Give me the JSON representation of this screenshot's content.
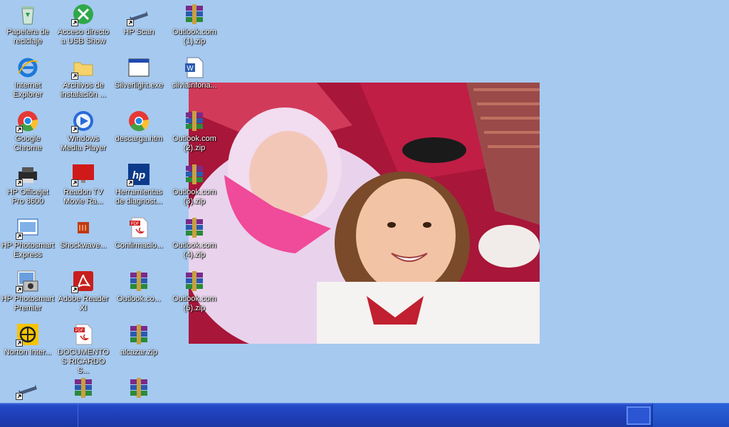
{
  "desktop": {
    "background_color": "#a6c9f0",
    "icons": [
      {
        "label": "Papelera de reciclaje",
        "icon": "recycle-bin-icon",
        "shortcut": false
      },
      {
        "label": "Acceso directo a USB Show",
        "icon": "usb-show-icon",
        "shortcut": true
      },
      {
        "label": "HP Scan",
        "icon": "scanner-icon",
        "shortcut": true
      },
      {
        "label": "Outlook.com (1).zip",
        "icon": "winrar-archive-icon",
        "shortcut": false
      },
      {
        "label": "Internet Explorer",
        "icon": "internet-explorer-icon",
        "shortcut": false
      },
      {
        "label": "Archivos de instalación ...",
        "icon": "folder-icon",
        "shortcut": true
      },
      {
        "label": "Silverlight.exe",
        "icon": "application-window-icon",
        "shortcut": false
      },
      {
        "label": "silviainfona...",
        "icon": "word-document-icon",
        "shortcut": false
      },
      {
        "label": "Google Chrome",
        "icon": "chrome-icon",
        "shortcut": true
      },
      {
        "label": "Windows Media Player",
        "icon": "media-player-icon",
        "shortcut": true
      },
      {
        "label": "descarga.htm",
        "icon": "chrome-icon",
        "shortcut": false
      },
      {
        "label": "Outlook.com (2).zip",
        "icon": "winrar-archive-icon",
        "shortcut": false
      },
      {
        "label": "HP Officejet Pro 8600",
        "icon": "printer-icon",
        "shortcut": true
      },
      {
        "label": "Readon TV Movie Ra...",
        "icon": "tv-icon",
        "shortcut": true
      },
      {
        "label": "Herramientas de diagnost...",
        "icon": "hp-logo-icon",
        "shortcut": true
      },
      {
        "label": "Outlook.com (3).zip",
        "icon": "winrar-archive-icon",
        "shortcut": false
      },
      {
        "label": "HP Photosmart Express",
        "icon": "hp-photosmart-icon",
        "shortcut": true
      },
      {
        "label": "Shockwave...",
        "icon": "shockwave-icon",
        "shortcut": false
      },
      {
        "label": "Confirmacio...",
        "icon": "pdf-document-icon",
        "shortcut": false
      },
      {
        "label": "Outlook.com (4).zip",
        "icon": "winrar-archive-icon",
        "shortcut": false
      },
      {
        "label": "HP Photosmart Premier",
        "icon": "photo-camera-icon",
        "shortcut": true
      },
      {
        "label": "Adobe Reader XI",
        "icon": "adobe-reader-icon",
        "shortcut": true
      },
      {
        "label": "Outlook.co...",
        "icon": "winrar-archive-icon",
        "shortcut": false
      },
      {
        "label": "Outlook.com (5).zip",
        "icon": "winrar-archive-icon",
        "shortcut": false
      },
      {
        "label": "Norton Inter...",
        "icon": "norton-icon",
        "shortcut": true
      },
      {
        "label": "DOCUMENTOS RICARDO S...",
        "icon": "pdf-document-icon",
        "shortcut": false
      },
      {
        "label": "alcazar.zip",
        "icon": "winrar-archive-icon",
        "shortcut": false
      },
      {
        "label": "",
        "icon": "scanner-icon",
        "shortcut": true
      },
      {
        "label": "",
        "icon": "winrar-archive-icon",
        "shortcut": false
      },
      {
        "label": "",
        "icon": "winrar-archive-icon",
        "shortcut": false
      }
    ]
  },
  "taskbar": {
    "color": "#2349c8",
    "tray_button_icon": "show-desktop-icon"
  }
}
